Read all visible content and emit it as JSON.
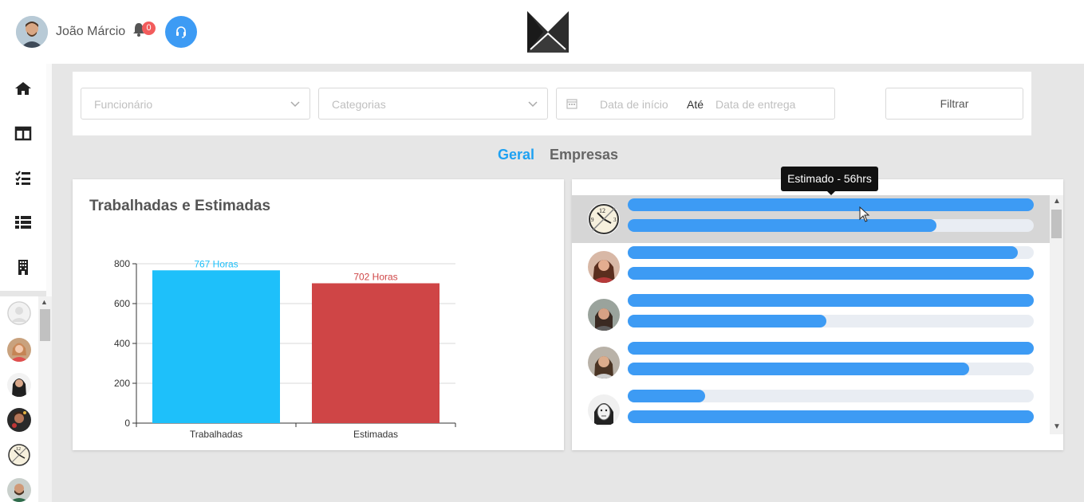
{
  "header": {
    "user_name": "João Márcio",
    "notification_count": "0",
    "support_icon": "headset-icon",
    "logo": "k-logo"
  },
  "sidebar": {
    "items": [
      {
        "icon": "home-icon"
      },
      {
        "icon": "columns-icon"
      },
      {
        "icon": "checklist-icon"
      },
      {
        "icon": "list-icon"
      },
      {
        "icon": "building-icon"
      }
    ],
    "users_count": 6
  },
  "filters": {
    "employee_placeholder": "Funcionário",
    "category_placeholder": "Categorias",
    "start_date_placeholder": "Data de início",
    "date_separator": "Até",
    "end_date_placeholder": "Data de entrega",
    "filter_button": "Filtrar"
  },
  "tabs": [
    {
      "label": "Geral",
      "active": true
    },
    {
      "label": "Empresas",
      "active": false
    }
  ],
  "chart": {
    "title": "Trabalhadas e Estimadas"
  },
  "chart_data": {
    "type": "bar",
    "title": "Trabalhadas e Estimadas",
    "categories": [
      "Trabalhadas",
      "Estimadas"
    ],
    "values": [
      767,
      702
    ],
    "data_labels": [
      "767 Horas",
      "702 Horas"
    ],
    "colors": [
      "#1ec0fa",
      "#cf4546"
    ],
    "ylim": [
      0,
      800
    ],
    "yticks": [
      0,
      200,
      400,
      600,
      800
    ],
    "grid": true
  },
  "progress": {
    "tooltip": "Estimado - 56hrs",
    "bar_color": "#3d9bf4",
    "rows": [
      {
        "worked": 1.0,
        "estimated": 0.76,
        "highlighted": true
      },
      {
        "worked": 0.96,
        "estimated": 1.0,
        "highlighted": false
      },
      {
        "worked": 1.0,
        "estimated": 0.49,
        "highlighted": false
      },
      {
        "worked": 1.0,
        "estimated": 0.84,
        "highlighted": false
      },
      {
        "worked": 0.19,
        "estimated": 1.0,
        "highlighted": false
      }
    ]
  }
}
